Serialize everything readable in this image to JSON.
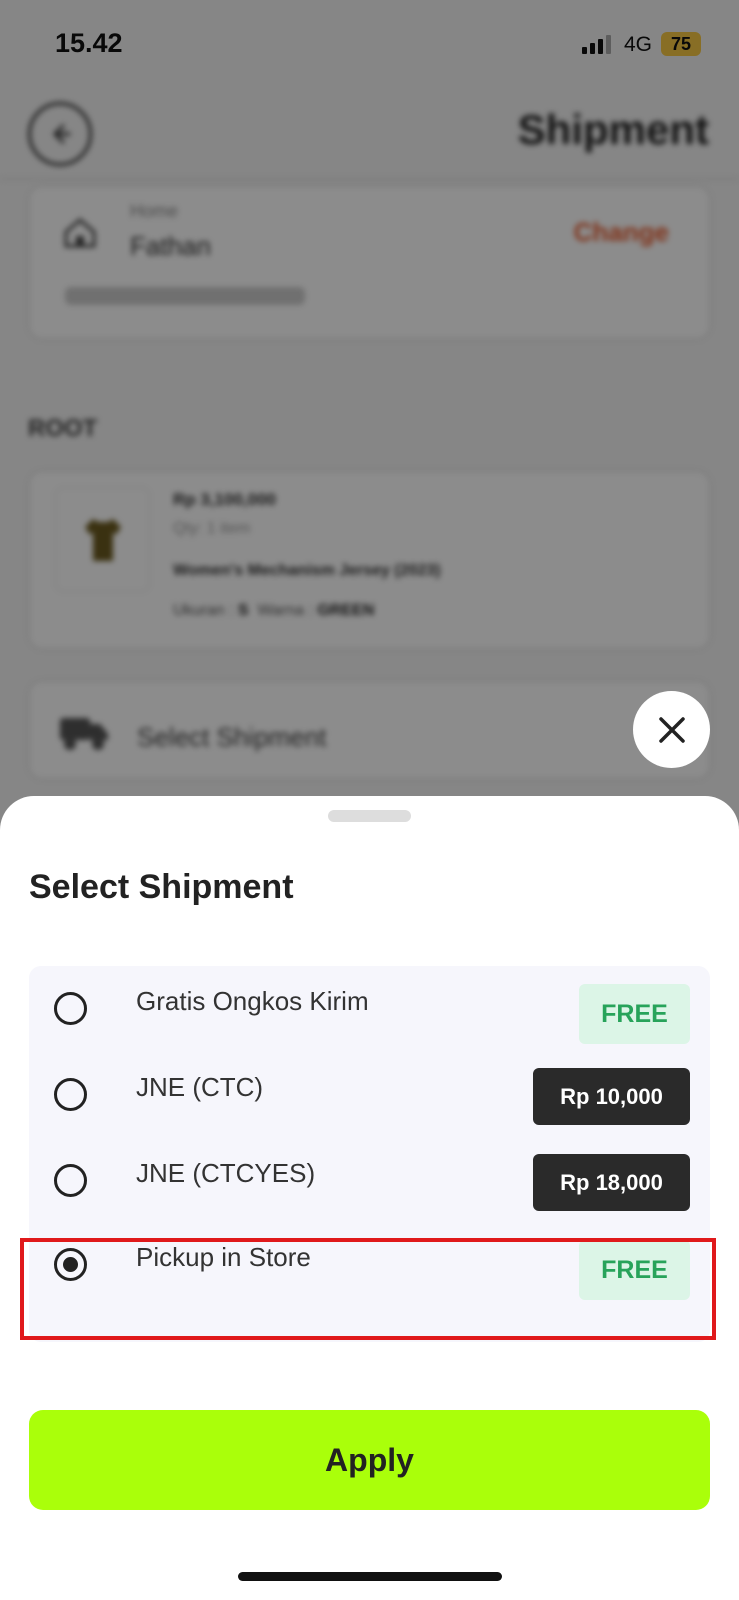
{
  "status_bar": {
    "time": "15.42",
    "network": "4G",
    "battery": "75"
  },
  "header": {
    "title": "Shipment"
  },
  "address": {
    "label": "Home",
    "name": "Fathan",
    "change_label": "Change"
  },
  "store": {
    "name": "ROOT"
  },
  "product": {
    "price": "Rp 3,100,000",
    "qty": "Qty: 1 item",
    "name": "Women's Mechanism Jersey (2023)",
    "size_label": "Ukuran :",
    "size_value": "S",
    "color_label": "Warna :",
    "color_value": "GREEN"
  },
  "shipment_row": {
    "label": "Select Shipment"
  },
  "sheet": {
    "title": "Select Shipment",
    "options": [
      {
        "label": "Gratis Ongkos Kirim",
        "price": "FREE",
        "selected": false
      },
      {
        "label": "JNE (CTC)",
        "price": "Rp 10,000",
        "selected": false
      },
      {
        "label": "JNE (CTCYES)",
        "price": "Rp 18,000",
        "selected": false
      },
      {
        "label": "Pickup in Store",
        "price": "FREE",
        "selected": true
      }
    ],
    "apply_label": "Apply"
  },
  "colors": {
    "accent": "#aaff0a",
    "free_text": "#27a35a",
    "free_bg": "#dcf5e7",
    "change": "#e85a2c",
    "highlight": "#e0191b"
  }
}
